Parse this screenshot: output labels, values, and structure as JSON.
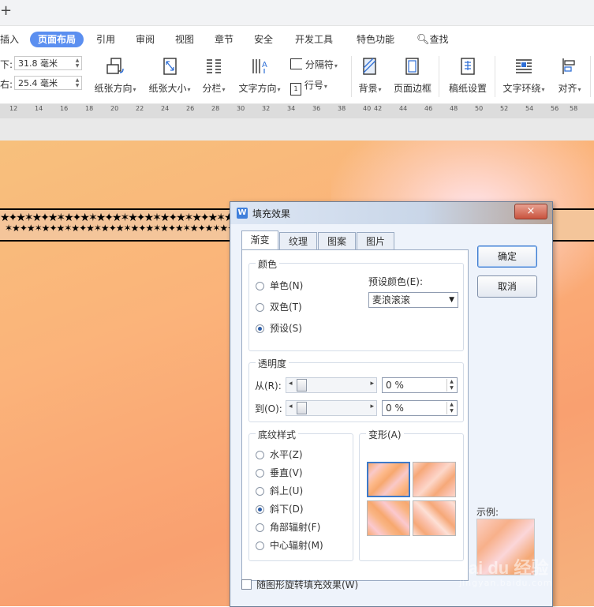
{
  "menu": {
    "items": [
      "插入",
      "页面布局",
      "引用",
      "审阅",
      "视图",
      "章节",
      "安全",
      "开发工具",
      "特色功能",
      "查找"
    ],
    "active": "页面布局"
  },
  "toolbar": {
    "margin_bottom_label": "下:",
    "margin_bottom_value": "31.8 毫米",
    "margin_right_label": "右:",
    "margin_right_value": "25.4 毫米",
    "orientation": "纸张方向",
    "paper_size": "纸张大小",
    "columns": "分栏",
    "text_direction": "文字方向",
    "separator": "分隔符",
    "line_number": "行号",
    "background": "背景",
    "page_border": "页面边框",
    "manuscript": "稿纸设置",
    "text_wrap": "文字环绕",
    "align": "对齐"
  },
  "ruler": {
    "ticks": [
      "12",
      "14",
      "16",
      "18",
      "20",
      "22",
      "24",
      "26",
      "28",
      "30",
      "32",
      "34",
      "36",
      "38",
      "40",
      "42",
      "44",
      "46",
      "48",
      "50",
      "52",
      "54",
      "56",
      "58"
    ]
  },
  "dialog": {
    "title": "填充效果",
    "close": "×",
    "tabs": [
      "渐变",
      "纹理",
      "图案",
      "图片"
    ],
    "active_tab": "渐变",
    "color_group": "颜色",
    "color_options": [
      "单色(N)",
      "双色(T)",
      "预设(S)"
    ],
    "color_selected": "预设(S)",
    "preset_label": "预设颜色(E):",
    "preset_value": "麦浪滚滚",
    "transparency_group": "透明度",
    "from_label": "从(R):",
    "from_value": "0 %",
    "to_label": "到(O):",
    "to_value": "0 %",
    "shading_group": "底纹样式",
    "shading_options": [
      "水平(Z)",
      "垂直(V)",
      "斜上(U)",
      "斜下(D)",
      "角部辐射(F)",
      "中心辐射(M)"
    ],
    "shading_selected": "斜下(D)",
    "variants_group": "变形(A)",
    "ok": "确定",
    "cancel": "取消",
    "sample_label": "示例:",
    "rotate_checkbox": "随图形旋转填充效果(W)"
  },
  "watermark": {
    "brand": "Bai du 经验",
    "url": "jingyan.baidu.com"
  }
}
